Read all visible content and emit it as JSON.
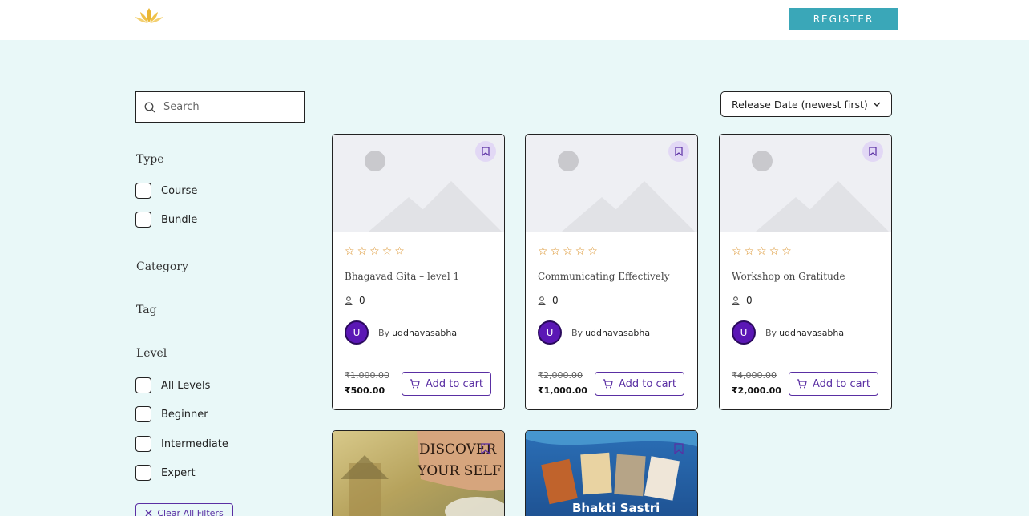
{
  "header": {
    "register_label": "REGISTER"
  },
  "search": {
    "placeholder": "Search"
  },
  "filters": {
    "type_heading": "Type",
    "type_options": [
      "Course",
      "Bundle"
    ],
    "category_heading": "Category",
    "tag_heading": "Tag",
    "level_heading": "Level",
    "level_options": [
      "All Levels",
      "Beginner",
      "Intermediate",
      "Expert"
    ],
    "clear_label": "Clear All Filters"
  },
  "sort": {
    "selected": "Release Date (newest first)"
  },
  "courses": [
    {
      "title": "Bhagavad Gita – level 1",
      "rating": 0,
      "students": "0",
      "by": "By",
      "author": "uddhavasabha",
      "avatar_letter": "U",
      "old_price": "₹1,000.00",
      "new_price": "₹500.00",
      "cart_label": "Add to cart"
    },
    {
      "title": "Communicating Effectively",
      "rating": 0,
      "students": "0",
      "by": "By",
      "author": "uddhavasabha",
      "avatar_letter": "U",
      "old_price": "₹2,000.00",
      "new_price": "₹1,000.00",
      "cart_label": "Add to cart"
    },
    {
      "title": "Workshop on Gratitude",
      "rating": 0,
      "students": "0",
      "by": "By",
      "author": "uddhavasabha",
      "avatar_letter": "U",
      "old_price": "₹4,000.00",
      "new_price": "₹2,000.00",
      "cart_label": "Add to cart"
    }
  ],
  "bottom_cards": [
    {
      "image_text_line1": "DISCOVER",
      "image_text_line2": "YOUR SELF"
    },
    {
      "image_text": "Bhakti Sastri"
    }
  ],
  "colors": {
    "accent": "#3aa7b8",
    "purple": "#5a2fa3",
    "star": "#d98c1f",
    "background": "#e9f8f8"
  }
}
